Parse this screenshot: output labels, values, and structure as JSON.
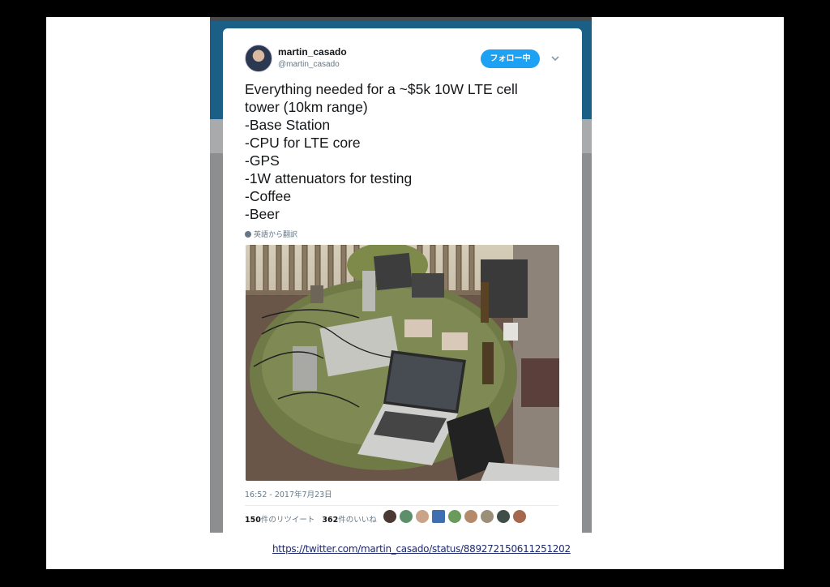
{
  "tweet": {
    "display_name": "martin_casado",
    "handle": "@martin_casado",
    "follow_label": "フォロー中",
    "text_lines": [
      "Everything needed for a ~$5k 10W LTE cell",
      "tower (10km range)",
      "-Base Station",
      "-CPU for LTE core",
      "-GPS",
      "-1W attenuators for testing",
      "-Coffee",
      "-Beer"
    ],
    "translate_label": "英語から翻訳",
    "timestamp": "16:52 - 2017年7月23日",
    "retweet_count": "150",
    "retweet_label": "件のリツイート",
    "like_count": "362",
    "like_label": "件のいいね"
  },
  "slide": {
    "url": "https://twitter.com/martin_casado/status/889272150611251202"
  },
  "colors": {
    "follow_button": "#1da1f2",
    "header_banner": "#1b5f86",
    "link": "#1e2a6e"
  },
  "icons": {
    "translate": "globe-icon",
    "menu": "chevron-down-icon"
  }
}
